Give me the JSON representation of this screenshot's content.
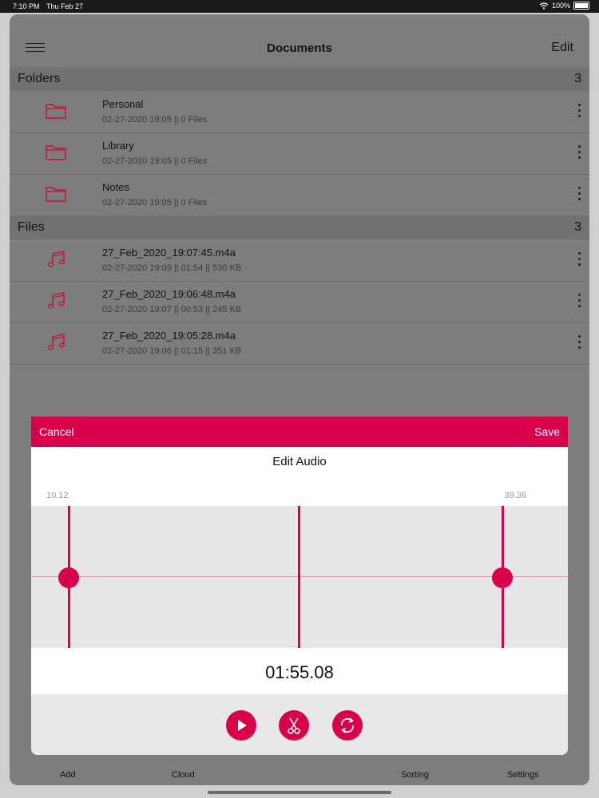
{
  "status": {
    "time": "7:10 PM",
    "date": "Thu Feb 27",
    "battery": "100%"
  },
  "header": {
    "title": "Documents",
    "edit_label": "Edit"
  },
  "folders": {
    "label": "Folders",
    "count": "3",
    "items": [
      {
        "name": "Personal",
        "meta": "02-27-2020 19:05 || 0 Files"
      },
      {
        "name": "Library",
        "meta": "02-27-2020 19:05 || 0 Files"
      },
      {
        "name": "Notes",
        "meta": "02-27-2020 19:05 || 0 Files"
      }
    ]
  },
  "files": {
    "label": "Files",
    "count": "3",
    "items": [
      {
        "name": "27_Feb_2020_19:07:45.m4a",
        "meta": "02-27-2020 19:09 || 01:54 || 530 KB"
      },
      {
        "name": "27_Feb_2020_19:06:48.m4a",
        "meta": "02-27-2020 19:07 || 00:53 || 245 KB"
      },
      {
        "name": "27_Feb_2020_19:05:28.m4a",
        "meta": "02-27-2020 19:06 || 01:15 || 351 KB"
      }
    ]
  },
  "tabbar": {
    "add": "Add",
    "cloud": "Cloud",
    "sorting": "Sorting",
    "settings": "Settings"
  },
  "editor": {
    "cancel_label": "Cancel",
    "save_label": "Save",
    "title": "Edit Audio",
    "trim_start": "10.12",
    "trim_end": "39.36",
    "current_time": "01:55.08",
    "controls": {
      "play": "play-icon",
      "cut": "scissors-icon",
      "loop": "loop-icon"
    }
  },
  "colors": {
    "accent": "#d8004a",
    "icon": "#c4103d"
  }
}
